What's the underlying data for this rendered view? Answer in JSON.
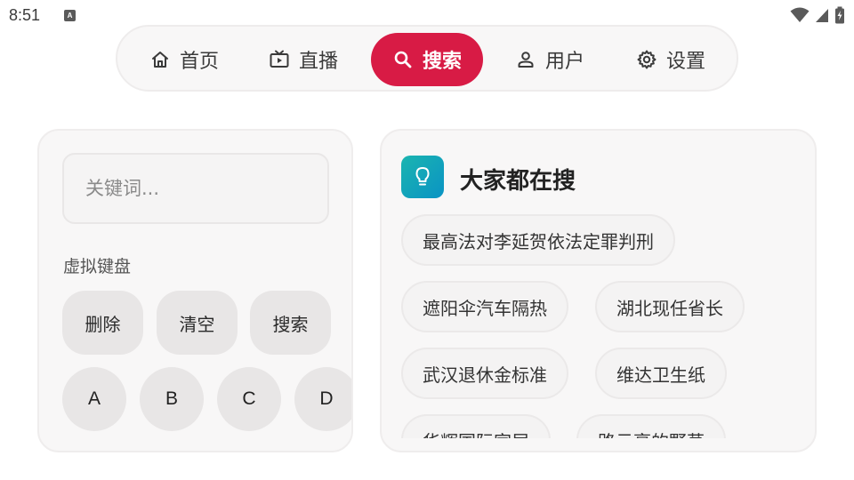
{
  "status_bar": {
    "time": "8:51",
    "notification_glyph": "A"
  },
  "nav": {
    "items": [
      {
        "label": "首页",
        "icon": "home-icon"
      },
      {
        "label": "直播",
        "icon": "tv-icon"
      },
      {
        "label": "搜索",
        "icon": "search-icon",
        "active": true
      },
      {
        "label": "用户",
        "icon": "user-icon"
      },
      {
        "label": "设置",
        "icon": "gear-icon"
      }
    ],
    "active_color": "#d81b45"
  },
  "search": {
    "placeholder": "关键词...",
    "value": ""
  },
  "keyboard": {
    "label": "虚拟键盘",
    "actions": {
      "delete": "删除",
      "clear": "清空",
      "search": "搜索"
    },
    "keys": [
      "A",
      "B",
      "C",
      "D"
    ]
  },
  "trending": {
    "title": "大家都在搜",
    "icon": "lightbulb-icon",
    "items": [
      "最高法对李延贺依法定罪判刑",
      "遮阳伞汽车隔热",
      "湖北现任省长",
      "武汉退休金标准",
      "维达卫生纸",
      "华辉国际家居",
      "路云亭的野草"
    ]
  }
}
